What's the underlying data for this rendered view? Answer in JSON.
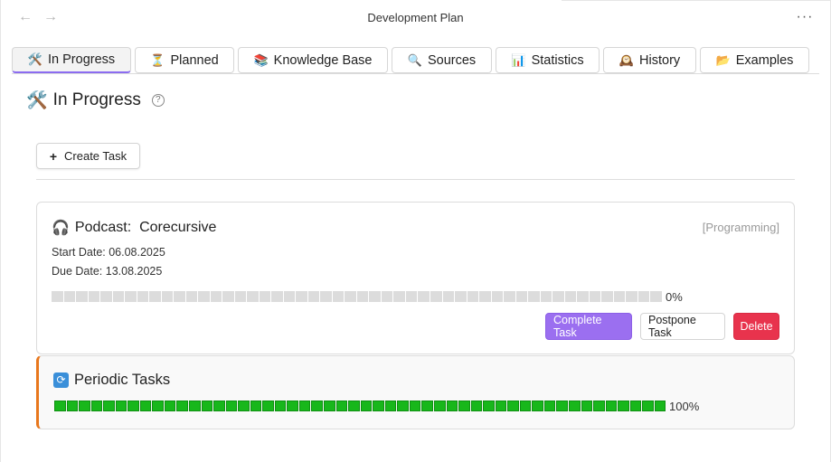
{
  "window": {
    "title": "Development Plan",
    "back_icon": "←",
    "forward_icon": "→",
    "more_icon": "···"
  },
  "tabs": [
    {
      "icon": "🛠️",
      "label": "In Progress",
      "active": true
    },
    {
      "icon": "⏳",
      "label": "Planned",
      "active": false
    },
    {
      "icon": "📚",
      "label": "Knowledge Base",
      "active": false
    },
    {
      "icon": "🔍",
      "label": "Sources",
      "active": false
    },
    {
      "icon": "📊",
      "label": "Statistics",
      "active": false
    },
    {
      "icon": "🕰️",
      "label": "History",
      "active": false
    },
    {
      "icon": "📂",
      "label": "Examples",
      "active": false
    }
  ],
  "heading": {
    "icon": "🛠️",
    "text": "In Progress",
    "help_icon": "?"
  },
  "create_button": {
    "icon": "+",
    "label": "Create Task"
  },
  "task": {
    "icon": "🎧",
    "title": "Podcast:  Corecursive",
    "tag": "[Programming]",
    "start_date": "Start Date: 06.08.2025",
    "due_date": "Due Date: 13.08.2025",
    "progress": 0,
    "progress_label": "0%",
    "actions": {
      "complete": "Complete Task",
      "postpone": "Postpone Task",
      "delete": "Delete"
    }
  },
  "periodic": {
    "icon": "🔄",
    "title": "Periodic Tasks",
    "progress": 100,
    "progress_label": "100%"
  },
  "colors": {
    "accent": "#9b6ff0",
    "delete": "#e8334d",
    "progress_full": "#18b71b",
    "progress_empty": "#dcdcdc",
    "periodic_border": "#e8771c"
  }
}
